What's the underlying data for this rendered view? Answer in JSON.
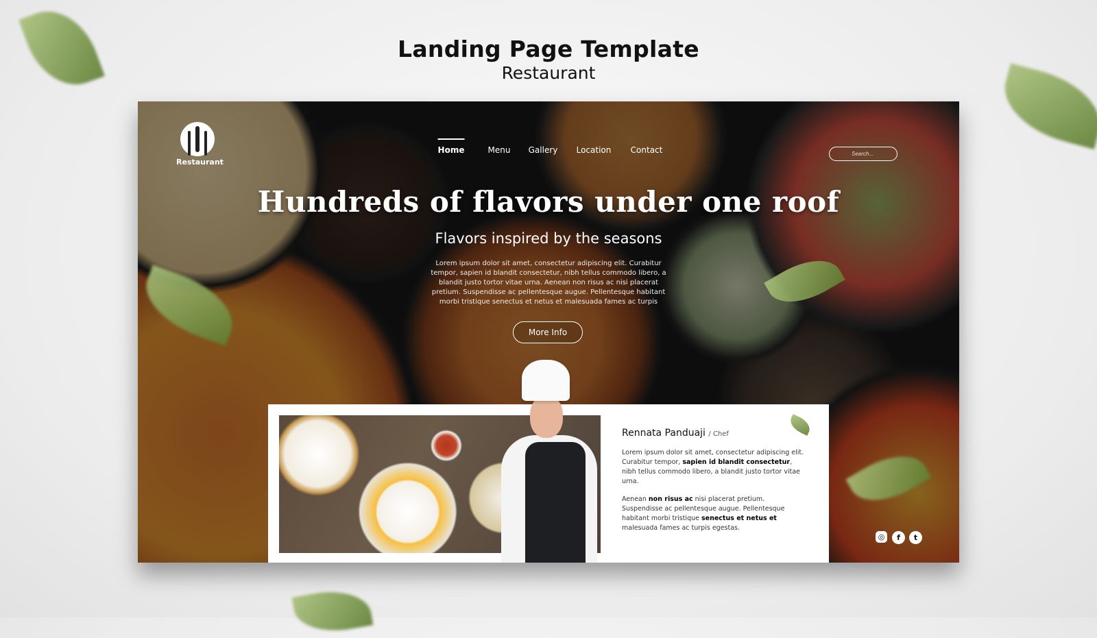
{
  "header": {
    "title": "Landing Page Template",
    "subtitle": "Restaurant"
  },
  "site": {
    "logo_text": "Restaurant",
    "nav": [
      {
        "label": "Home",
        "active": true
      },
      {
        "label": "Menu"
      },
      {
        "label": "Gallery"
      },
      {
        "label": "Location"
      },
      {
        "label": "Contact"
      }
    ],
    "search_placeholder": "Search...",
    "hero": {
      "headline": "Hundreds of flavors under one roof",
      "subheadline": "Flavors inspired by the seasons",
      "body": "Lorem ipsum dolor sit amet, consectetur adipiscing elit. Curabitur tempor, sapien id blandit consectetur, nibh tellus commodo libero, a blandit justo tortor vitae urna. Aenean non risus ac nisi placerat pretium. Suspendisse ac pellentesque augue. Pellentesque habitant morbi tristique senectus et netus et malesuada fames ac turpis",
      "button": "More Info"
    },
    "chef": {
      "name": "Rennata Panduaji",
      "role": "/ Chef",
      "bio1": [
        "Lorem ipsum dolor sit amet, consectetur adipiscing elit. Curabitur tempor, ",
        "sapien id blandit consectetur",
        ", nibh tellus commodo libero, a blandit justo tortor vitae urna."
      ],
      "bio2": [
        "Aenean ",
        "non risus ac",
        " nisi placerat pretium. Suspendisse ac pellentesque augue. Pellentesque habitant morbi tristique ",
        "senectus et netus et",
        " malesuada fames ac turpis egestas."
      ]
    },
    "social": [
      {
        "icon": "instagram-icon",
        "glyph": "◎"
      },
      {
        "icon": "facebook-icon",
        "glyph": "f"
      },
      {
        "icon": "twitter-icon",
        "glyph": "t"
      }
    ]
  },
  "colors": {
    "leaf": "#6f8f3a",
    "dark_bg": "#151515",
    "card": "#ffffff"
  }
}
